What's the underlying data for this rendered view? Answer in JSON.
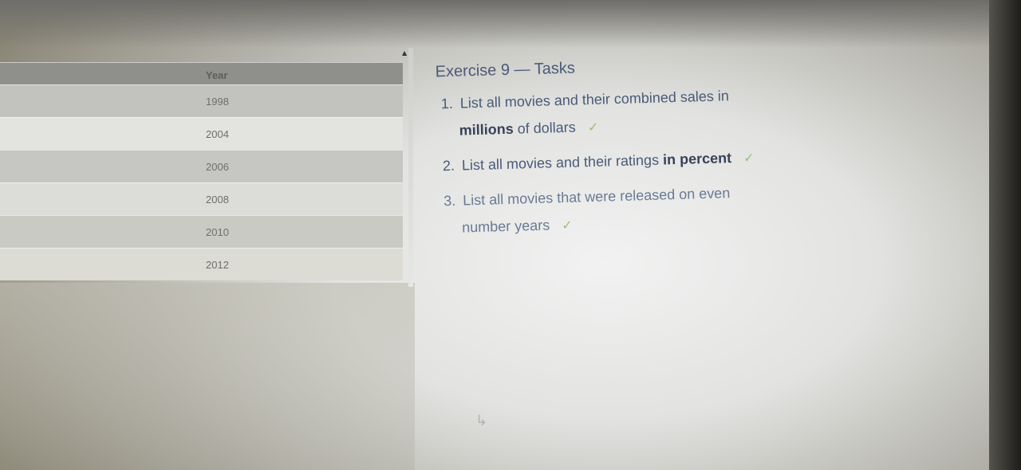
{
  "table": {
    "header": "Year",
    "rows": [
      "1998",
      "2004",
      "2006",
      "2008",
      "2010",
      "2012"
    ]
  },
  "panel": {
    "title": "Exercise 9 — Tasks",
    "tasks": [
      {
        "number": "1.",
        "text_before": "List all movies and their combined sales in",
        "bold": "millions",
        "text_after": "of dollars"
      },
      {
        "number": "2.",
        "text_before": "List all movies and their ratings",
        "bold": "in percent",
        "text_after": ""
      },
      {
        "number": "3.",
        "text_before": "List all movies that were released on even",
        "bold": "",
        "text_after": "number years"
      }
    ],
    "check_glyph": "✓"
  },
  "icons": {
    "scroll": "caret-up-icon",
    "check": "checkmark-icon",
    "cursor": "mouse-cursor-icon"
  },
  "colors": {
    "text": "#4a5a78",
    "check": "#9bbf7a",
    "header": "#8f8f8c"
  }
}
